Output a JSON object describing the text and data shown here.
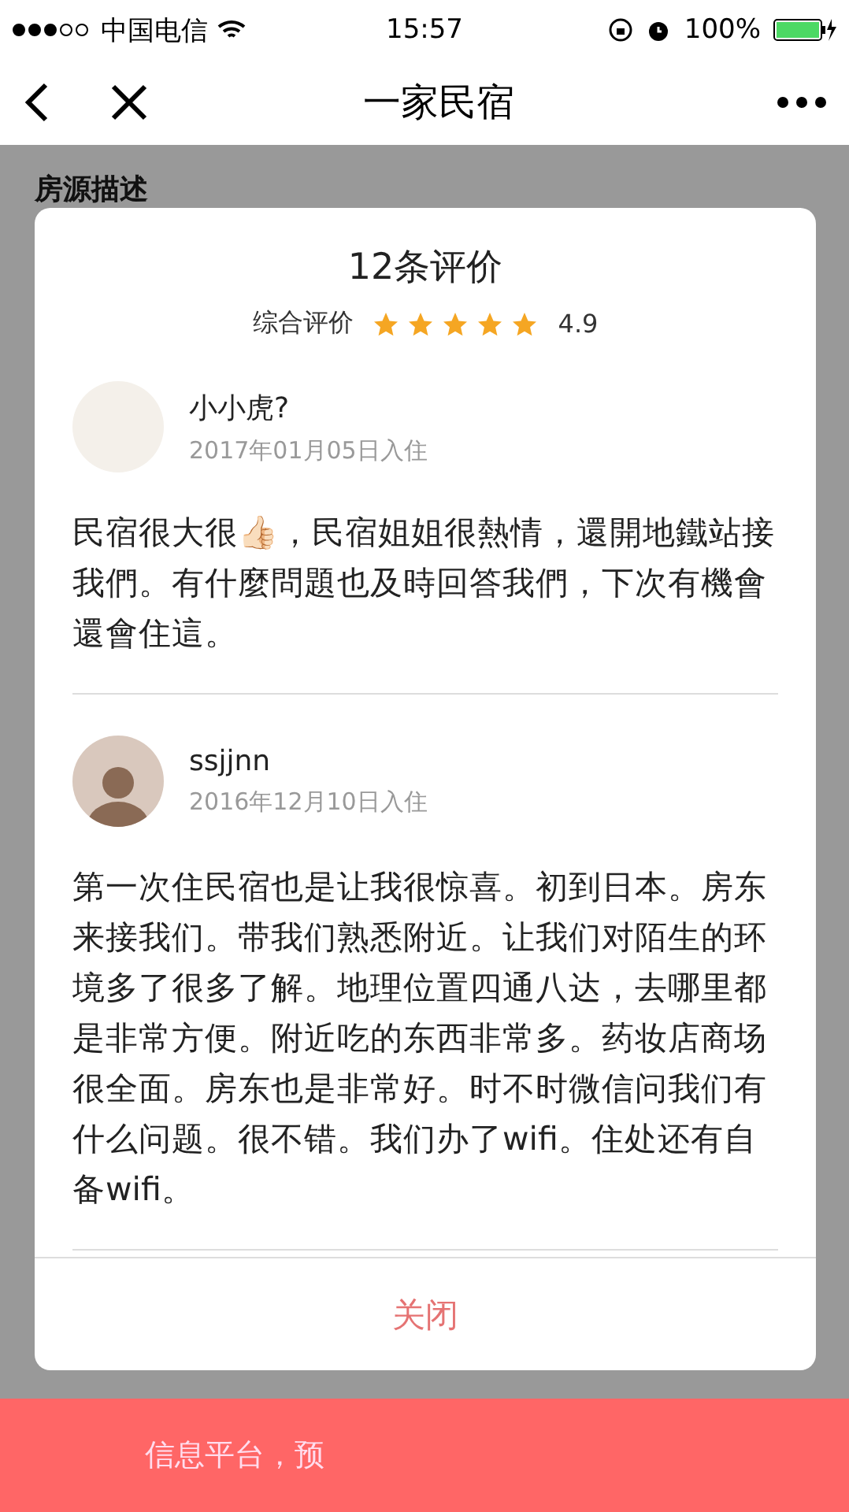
{
  "status_bar": {
    "carrier": "中国电信",
    "time": "15:57",
    "battery": "100%"
  },
  "nav": {
    "title": "一家民宿"
  },
  "background": {
    "section_title": "房源描述",
    "bottom_bar": "信息平台，预"
  },
  "modal": {
    "title": "12条评价",
    "rating_label": "综合评价",
    "stars": 5,
    "score": "4.9",
    "reviews": [
      {
        "name": "小小虎?",
        "date": "2017年01月05日入住",
        "kind": "logo",
        "text": "民宿很大很👍🏻，民宿姐姐很熱情，還開地鐵站接我們。有什麼問題也及時回答我們，下次有機會還會住這。"
      },
      {
        "name": "ssjjnn",
        "date": "2016年12月10日入住",
        "kind": "person",
        "text": "第一次住民宿也是让我很惊喜。初到日本。房东来接我们。带我们熟悉附近。让我们对陌生的环境多了很多了解。地理位置四通八达，去哪里都是非常方便。附近吃的东西非常多。药妆店商场很全面。房东也是非常好。时不时微信问我们有什么问题。很不错。我们办了wifi。住处还有自备wifi。"
      }
    ],
    "close_button": "关闭"
  }
}
